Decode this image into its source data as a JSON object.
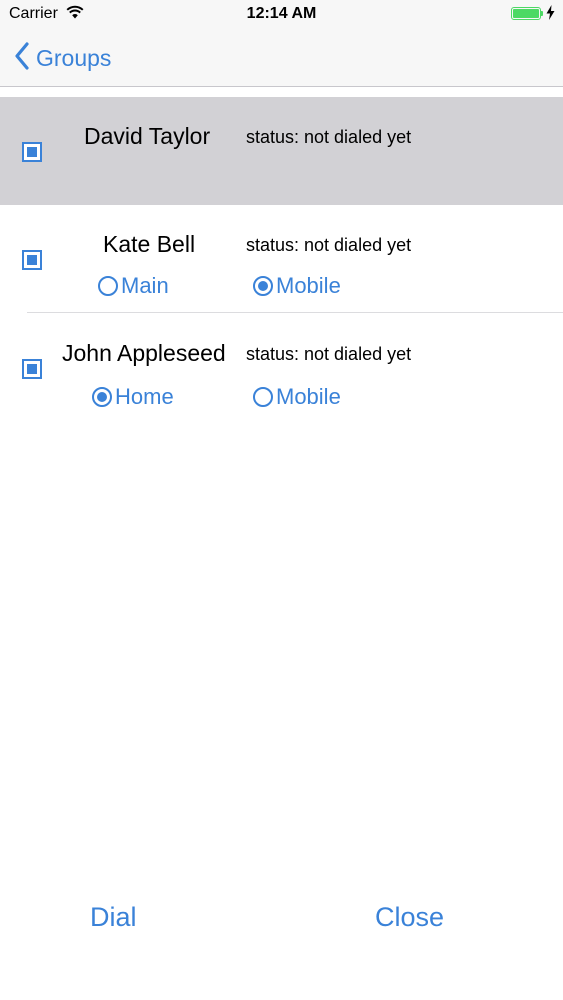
{
  "status_bar": {
    "carrier": "Carrier",
    "time": "12:14 AM",
    "battery_color": "#4cd964"
  },
  "nav": {
    "back_label": "Groups"
  },
  "contacts": [
    {
      "name": "David Taylor",
      "status": "status: not dialed yet",
      "checked": true,
      "selected": true
    },
    {
      "name": "Kate Bell",
      "status": "status: not dialed yet",
      "checked": true,
      "selected": false,
      "options": [
        {
          "label": "Main",
          "selected": false
        },
        {
          "label": "Mobile",
          "selected": true
        }
      ]
    },
    {
      "name": "John Appleseed",
      "status": "status: not dialed yet",
      "checked": true,
      "selected": false,
      "options": [
        {
          "label": "Home",
          "selected": true
        },
        {
          "label": "Mobile",
          "selected": false
        }
      ]
    }
  ],
  "footer": {
    "dial_label": "Dial",
    "close_label": "Close"
  },
  "colors": {
    "accent": "#3a82d8",
    "selected_row": "#d2d1d5"
  }
}
